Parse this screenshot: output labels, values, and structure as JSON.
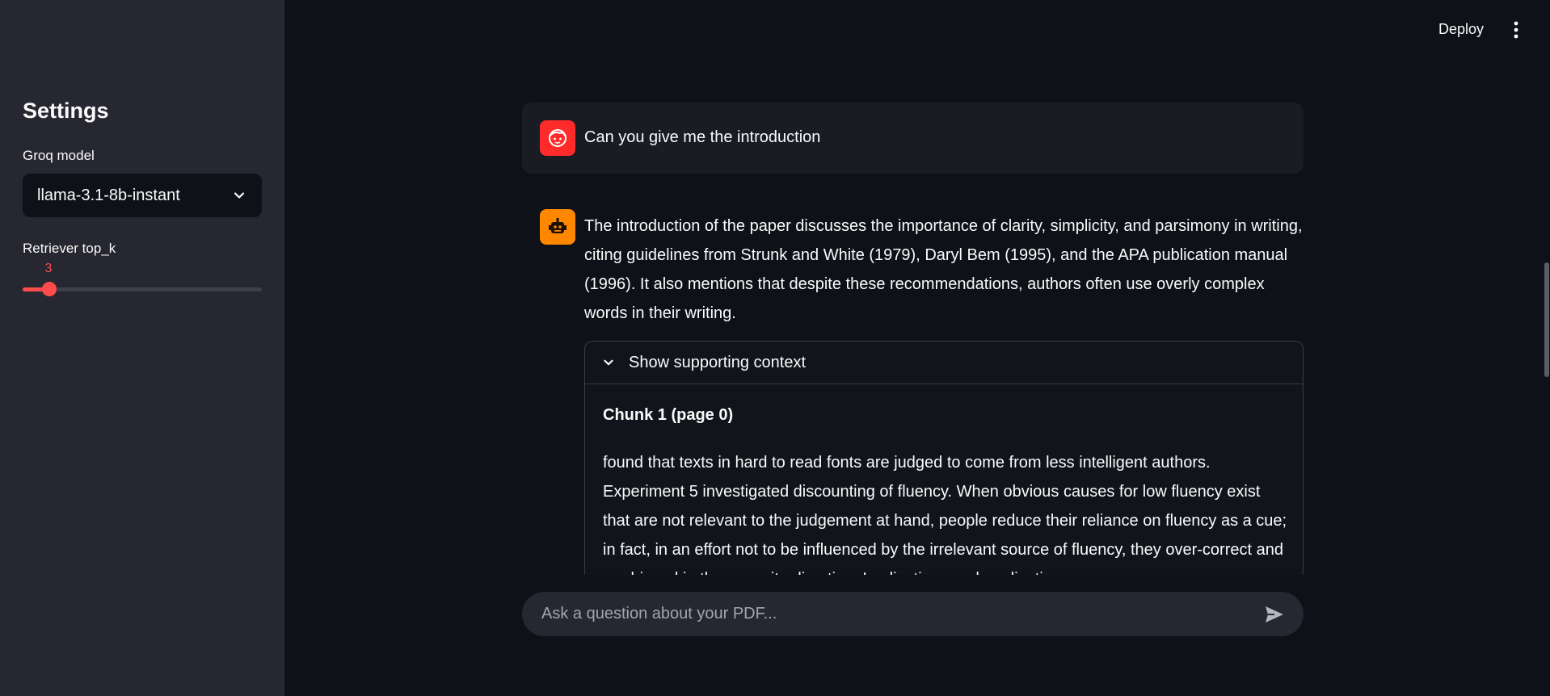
{
  "header": {
    "deploy_label": "Deploy",
    "menu_icon": "more-vertical-icon"
  },
  "sidebar": {
    "title": "Settings",
    "model_label": "Groq model",
    "model_value": "llama-3.1-8b-instant",
    "top_k_label": "Retriever top_k",
    "top_k_value": "3",
    "top_k_fraction": 0.11
  },
  "chat": {
    "user_message": "Can you give me the introduction",
    "assistant_message": "The introduction of the paper discusses the importance of clarity, simplicity, and parsimony in writing, citing guidelines from Strunk and White (1979), Daryl Bem (1995), and the APA publication manual (1996). It also mentions that despite these recommendations, authors often use overly complex words in their writing.",
    "expander": {
      "label": "Show supporting context",
      "chunk_title": "Chunk 1 (page 0)",
      "chunk_text": "found that texts in hard to read fonts are judged to come from less intelligent authors. Experiment 5 investigated discounting of fluency. When obvious causes for low fluency exist that are not relevant to the judgement at hand, people reduce their reliance on fluency as a cue; in fact, in an effort not to be influenced by the irrelevant source of fluency, they over-correct and are biased in the opposite direction. Implications and applications"
    },
    "input_placeholder": "Ask a question about your PDF..."
  },
  "colors": {
    "accent": "#ff4b4b",
    "user_avatar": "#ff2b2b",
    "assistant_avatar": "#ff8700",
    "background": "#0e1117",
    "sidebar": "#262730"
  }
}
